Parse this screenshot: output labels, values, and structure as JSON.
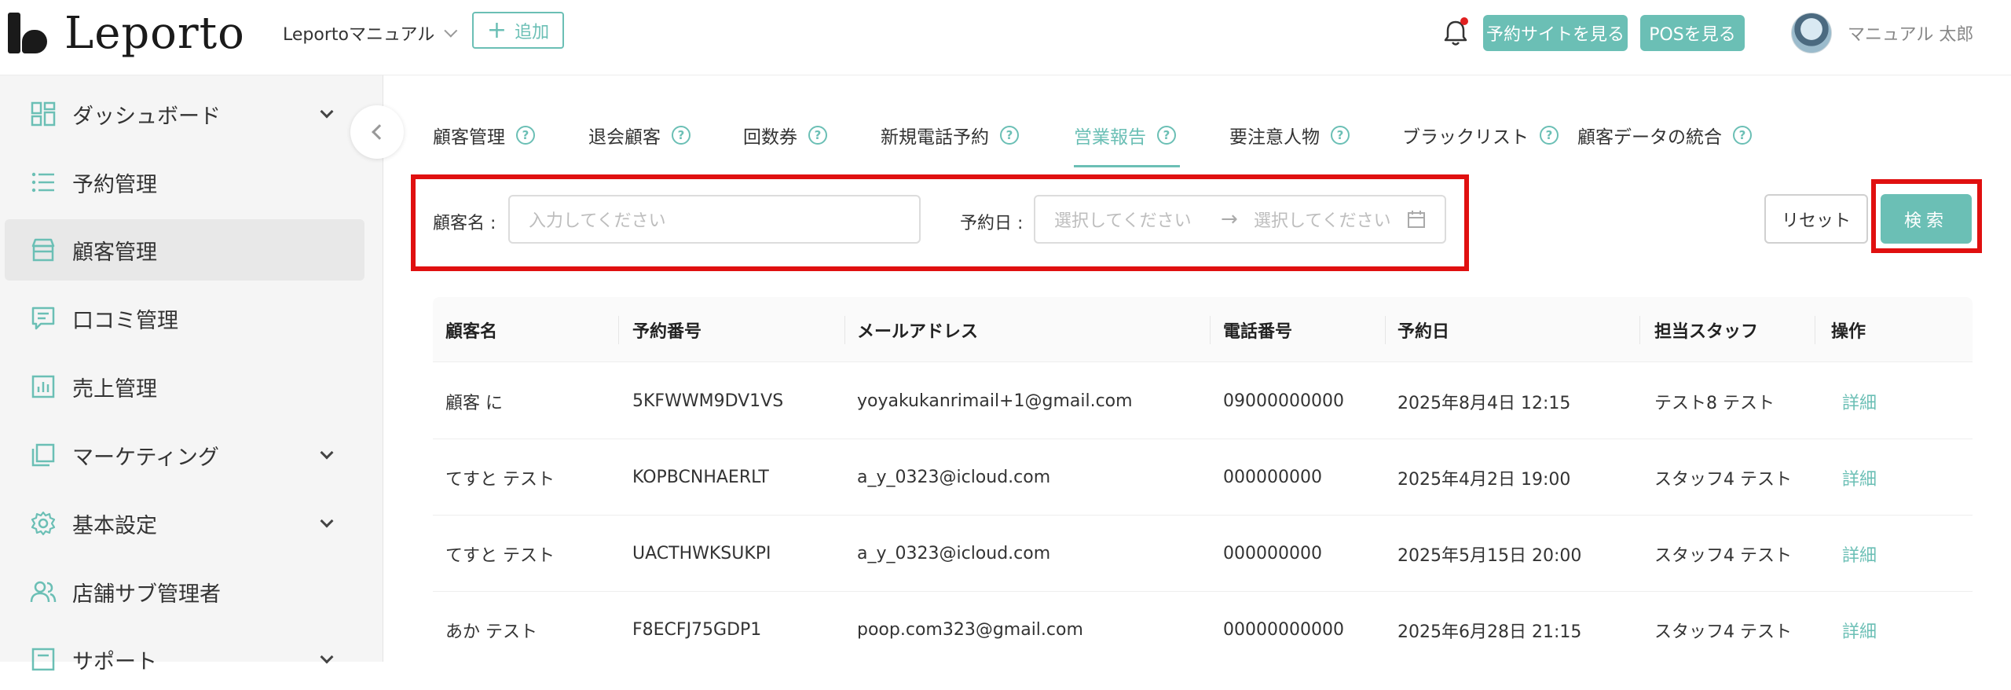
{
  "brand": {
    "name": "Leporto"
  },
  "header": {
    "store_name": "Leportoマニュアル",
    "add_label": "追加",
    "reserve_site_label": "予約サイトを見る",
    "pos_label": "POSを見る",
    "user_name": "マニュアル 太郎"
  },
  "colors": {
    "accent": "#6bbfb5",
    "highlight": "#e01010",
    "notification": "#e02020"
  },
  "sidebar": {
    "items": [
      {
        "label": "ダッシュボード",
        "icon": "dashboard-icon",
        "has_submenu": true
      },
      {
        "label": "予約管理",
        "icon": "list-icon",
        "has_submenu": false
      },
      {
        "label": "顧客管理",
        "icon": "store-icon",
        "has_submenu": false,
        "active": true
      },
      {
        "label": "口コミ管理",
        "icon": "review-icon",
        "has_submenu": false
      },
      {
        "label": "売上管理",
        "icon": "chart-icon",
        "has_submenu": false
      },
      {
        "label": "マーケティング",
        "icon": "marketing-icon",
        "has_submenu": true
      },
      {
        "label": "基本設定",
        "icon": "gear-icon",
        "has_submenu": true
      },
      {
        "label": "店舗サブ管理者",
        "icon": "users-icon",
        "has_submenu": false
      },
      {
        "label": "サポート",
        "icon": "support-icon",
        "has_submenu": true
      }
    ]
  },
  "tabs": [
    {
      "label": "顧客管理"
    },
    {
      "label": "退会顧客"
    },
    {
      "label": "回数券"
    },
    {
      "label": "新規電話予約"
    },
    {
      "label": "営業報告",
      "active": true
    },
    {
      "label": "要注意人物"
    },
    {
      "label": "ブラックリスト"
    },
    {
      "label": "顧客データの統合"
    }
  ],
  "search": {
    "customer_label": "顧客名 :",
    "customer_placeholder": "入力してください",
    "date_label": "予約日 :",
    "date_from_placeholder": "選択してください",
    "date_to_placeholder": "選択してください",
    "date_separator": "→",
    "reset_label": "リセット",
    "search_label": "検索"
  },
  "table": {
    "columns": [
      "顧客名",
      "予約番号",
      "メールアドレス",
      "電話番号",
      "予約日",
      "担当スタッフ",
      "操作"
    ],
    "rows": [
      [
        "顧客 に",
        "5KFWWM9DV1VS",
        "yoyakukanrimail+1@gmail.com",
        "09000000000",
        "2025年8月4日 12:15",
        "テスト8 テスト",
        "詳細"
      ],
      [
        "てすと テスト",
        "KOPBCNHAERLT",
        "a_y_0323@icloud.com",
        "000000000",
        "2025年4月2日 19:00",
        "スタッフ4 テスト",
        "詳細"
      ],
      [
        "てすと テスト",
        "UACTHWKSUKPI",
        "a_y_0323@icloud.com",
        "000000000",
        "2025年5月15日 20:00",
        "スタッフ4 テスト",
        "詳細"
      ],
      [
        "あか テスト",
        "F8ECFJ75GDP1",
        "poop.com323@gmail.com",
        "00000000000",
        "2025年6月28日 21:15",
        "スタッフ4 テスト",
        "詳細"
      ]
    ]
  }
}
